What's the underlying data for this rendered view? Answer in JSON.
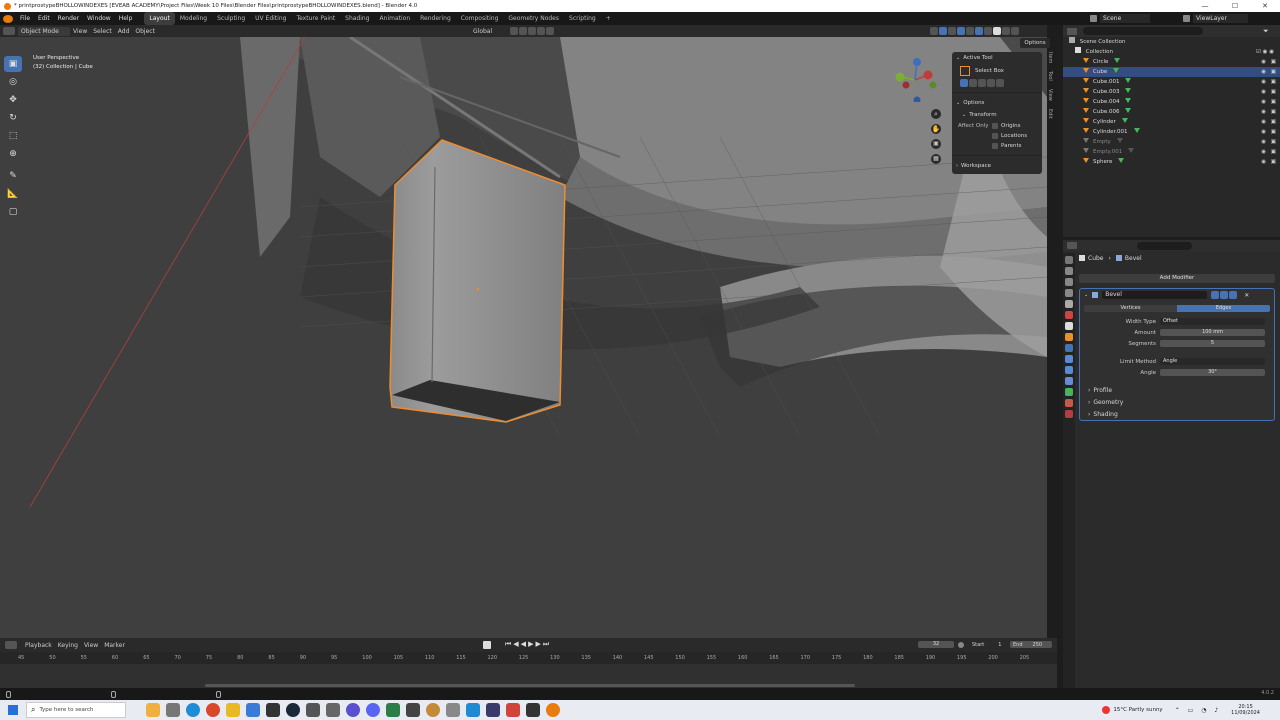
{
  "window": {
    "title": "* printprostypeBHOLLOWINDEXES [EVEAB ACADEMY\\Project Files\\Week 10 Files\\Blender Files\\printprostypeBHOLLOWINDEXES.blend] - Blender 4.0",
    "min": "—",
    "max": "☐",
    "close": "✕"
  },
  "menu": [
    "File",
    "Edit",
    "Render",
    "Window",
    "Help"
  ],
  "workspaces": [
    "Layout",
    "Modeling",
    "Sculpting",
    "UV Editing",
    "Texture Paint",
    "Shading",
    "Animation",
    "Rendering",
    "Compositing",
    "Geometry Nodes",
    "Scripting",
    "+"
  ],
  "scene": {
    "label": "Scene",
    "view_layer": "ViewLayer"
  },
  "vp_header": {
    "mode": "Object Mode",
    "menus": [
      "View",
      "Select",
      "Add",
      "Object"
    ],
    "orientation": "Global",
    "options": "Options"
  },
  "viewport": {
    "perspective": "User Perspective",
    "collection": "(32) Collection | Cube"
  },
  "npanel": {
    "active_tool_header": "Active Tool",
    "tool_name": "Select Box",
    "options_header": "Options",
    "transform_header": "Transform",
    "affect_only": "Affect Only",
    "origins": "Origins",
    "locations": "Locations",
    "parents": "Parents",
    "workspace_header": "Workspace",
    "tabs": [
      "Item",
      "Tool",
      "View",
      "Edit"
    ]
  },
  "outliner": {
    "scene_collection": "Scene Collection",
    "collection": "Collection",
    "items": [
      {
        "name": "Circle",
        "selected": false,
        "dim": false
      },
      {
        "name": "Cube",
        "selected": true,
        "dim": false
      },
      {
        "name": "Cube.001",
        "selected": false,
        "dim": false
      },
      {
        "name": "Cube.003",
        "selected": false,
        "dim": false
      },
      {
        "name": "Cube.004",
        "selected": false,
        "dim": false
      },
      {
        "name": "Cube.006",
        "selected": false,
        "dim": false
      },
      {
        "name": "Cylinder",
        "selected": false,
        "dim": false
      },
      {
        "name": "Cylinder.001",
        "selected": false,
        "dim": false
      },
      {
        "name": "Empty",
        "selected": false,
        "dim": true
      },
      {
        "name": "Empty.001",
        "selected": false,
        "dim": true
      },
      {
        "name": "Sphere",
        "selected": false,
        "dim": false
      }
    ]
  },
  "properties": {
    "breadcrumb_object": "Cube",
    "breadcrumb_modifier": "Bevel",
    "add_modifier": "Add Modifier",
    "modifier_name": "Bevel",
    "tab_vertices": "Vertices",
    "tab_edges": "Edges",
    "width_type_label": "Width Type",
    "width_type_value": "Offset",
    "amount_label": "Amount",
    "amount_value": "100 mm",
    "segments_label": "Segments",
    "segments_value": "5",
    "limit_method_label": "Limit Method",
    "limit_method_value": "Angle",
    "angle_label": "Angle",
    "angle_value": "30°",
    "profile": "Profile",
    "geometry": "Geometry",
    "shading": "Shading"
  },
  "timeline": {
    "menus": [
      "Playback",
      "Keying",
      "View",
      "Marker"
    ],
    "current_frame": "32",
    "start_label": "Start",
    "start_value": "1",
    "end_label": "End",
    "end_value": "250",
    "ticks": [
      "45",
      "50",
      "55",
      "60",
      "65",
      "70",
      "75",
      "80",
      "85",
      "90",
      "95",
      "100",
      "105",
      "110",
      "115",
      "120",
      "125",
      "130",
      "135",
      "140",
      "145",
      "150",
      "155",
      "160",
      "165",
      "170",
      "175",
      "180",
      "185",
      "190",
      "195",
      "200",
      "205"
    ]
  },
  "statusbar": {
    "version": "4.0.2"
  },
  "taskbar": {
    "search_placeholder": "Type here to search",
    "weather": "15°C  Partly sunny",
    "time": "20:15",
    "date": "11/09/2024"
  },
  "colors": {
    "accent": "#4772b3",
    "selection_outline": "#f08c2e",
    "viewport_bg": "#3f3f3f",
    "panel_bg": "#2b2b2b"
  }
}
